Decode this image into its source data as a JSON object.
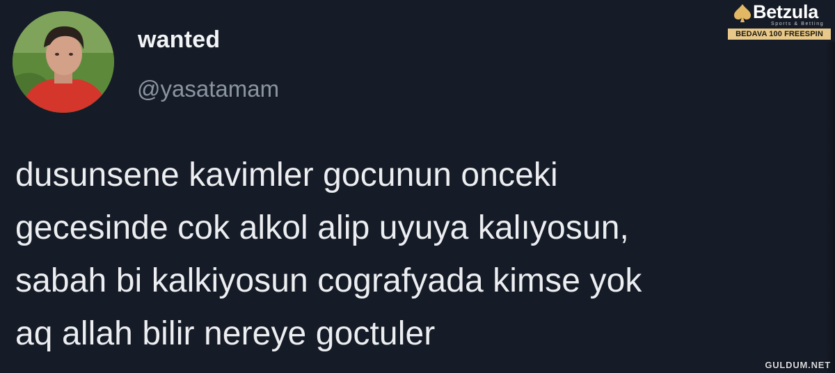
{
  "tweet": {
    "display_name": "wanted",
    "handle": "@yasatamam",
    "text": "dusunsene kavimler gocunun onceki\ngecesinde cok alkol alip uyuya kalıyosun,\nsabah bi kalkiyosun cografyada kimse yok\naq allah bilir nereye goctuler"
  },
  "brand_badge": {
    "icon": "spade-icon",
    "name": "Betzula",
    "tagline": "Sports & Betting",
    "promo": "BEDAVA 100 FREESPIN",
    "promo_color": "#e9c98a"
  },
  "watermark": "GULDUM.NET",
  "colors": {
    "background": "#161c27",
    "text": "#eceef1",
    "handle": "#8a95a1"
  }
}
